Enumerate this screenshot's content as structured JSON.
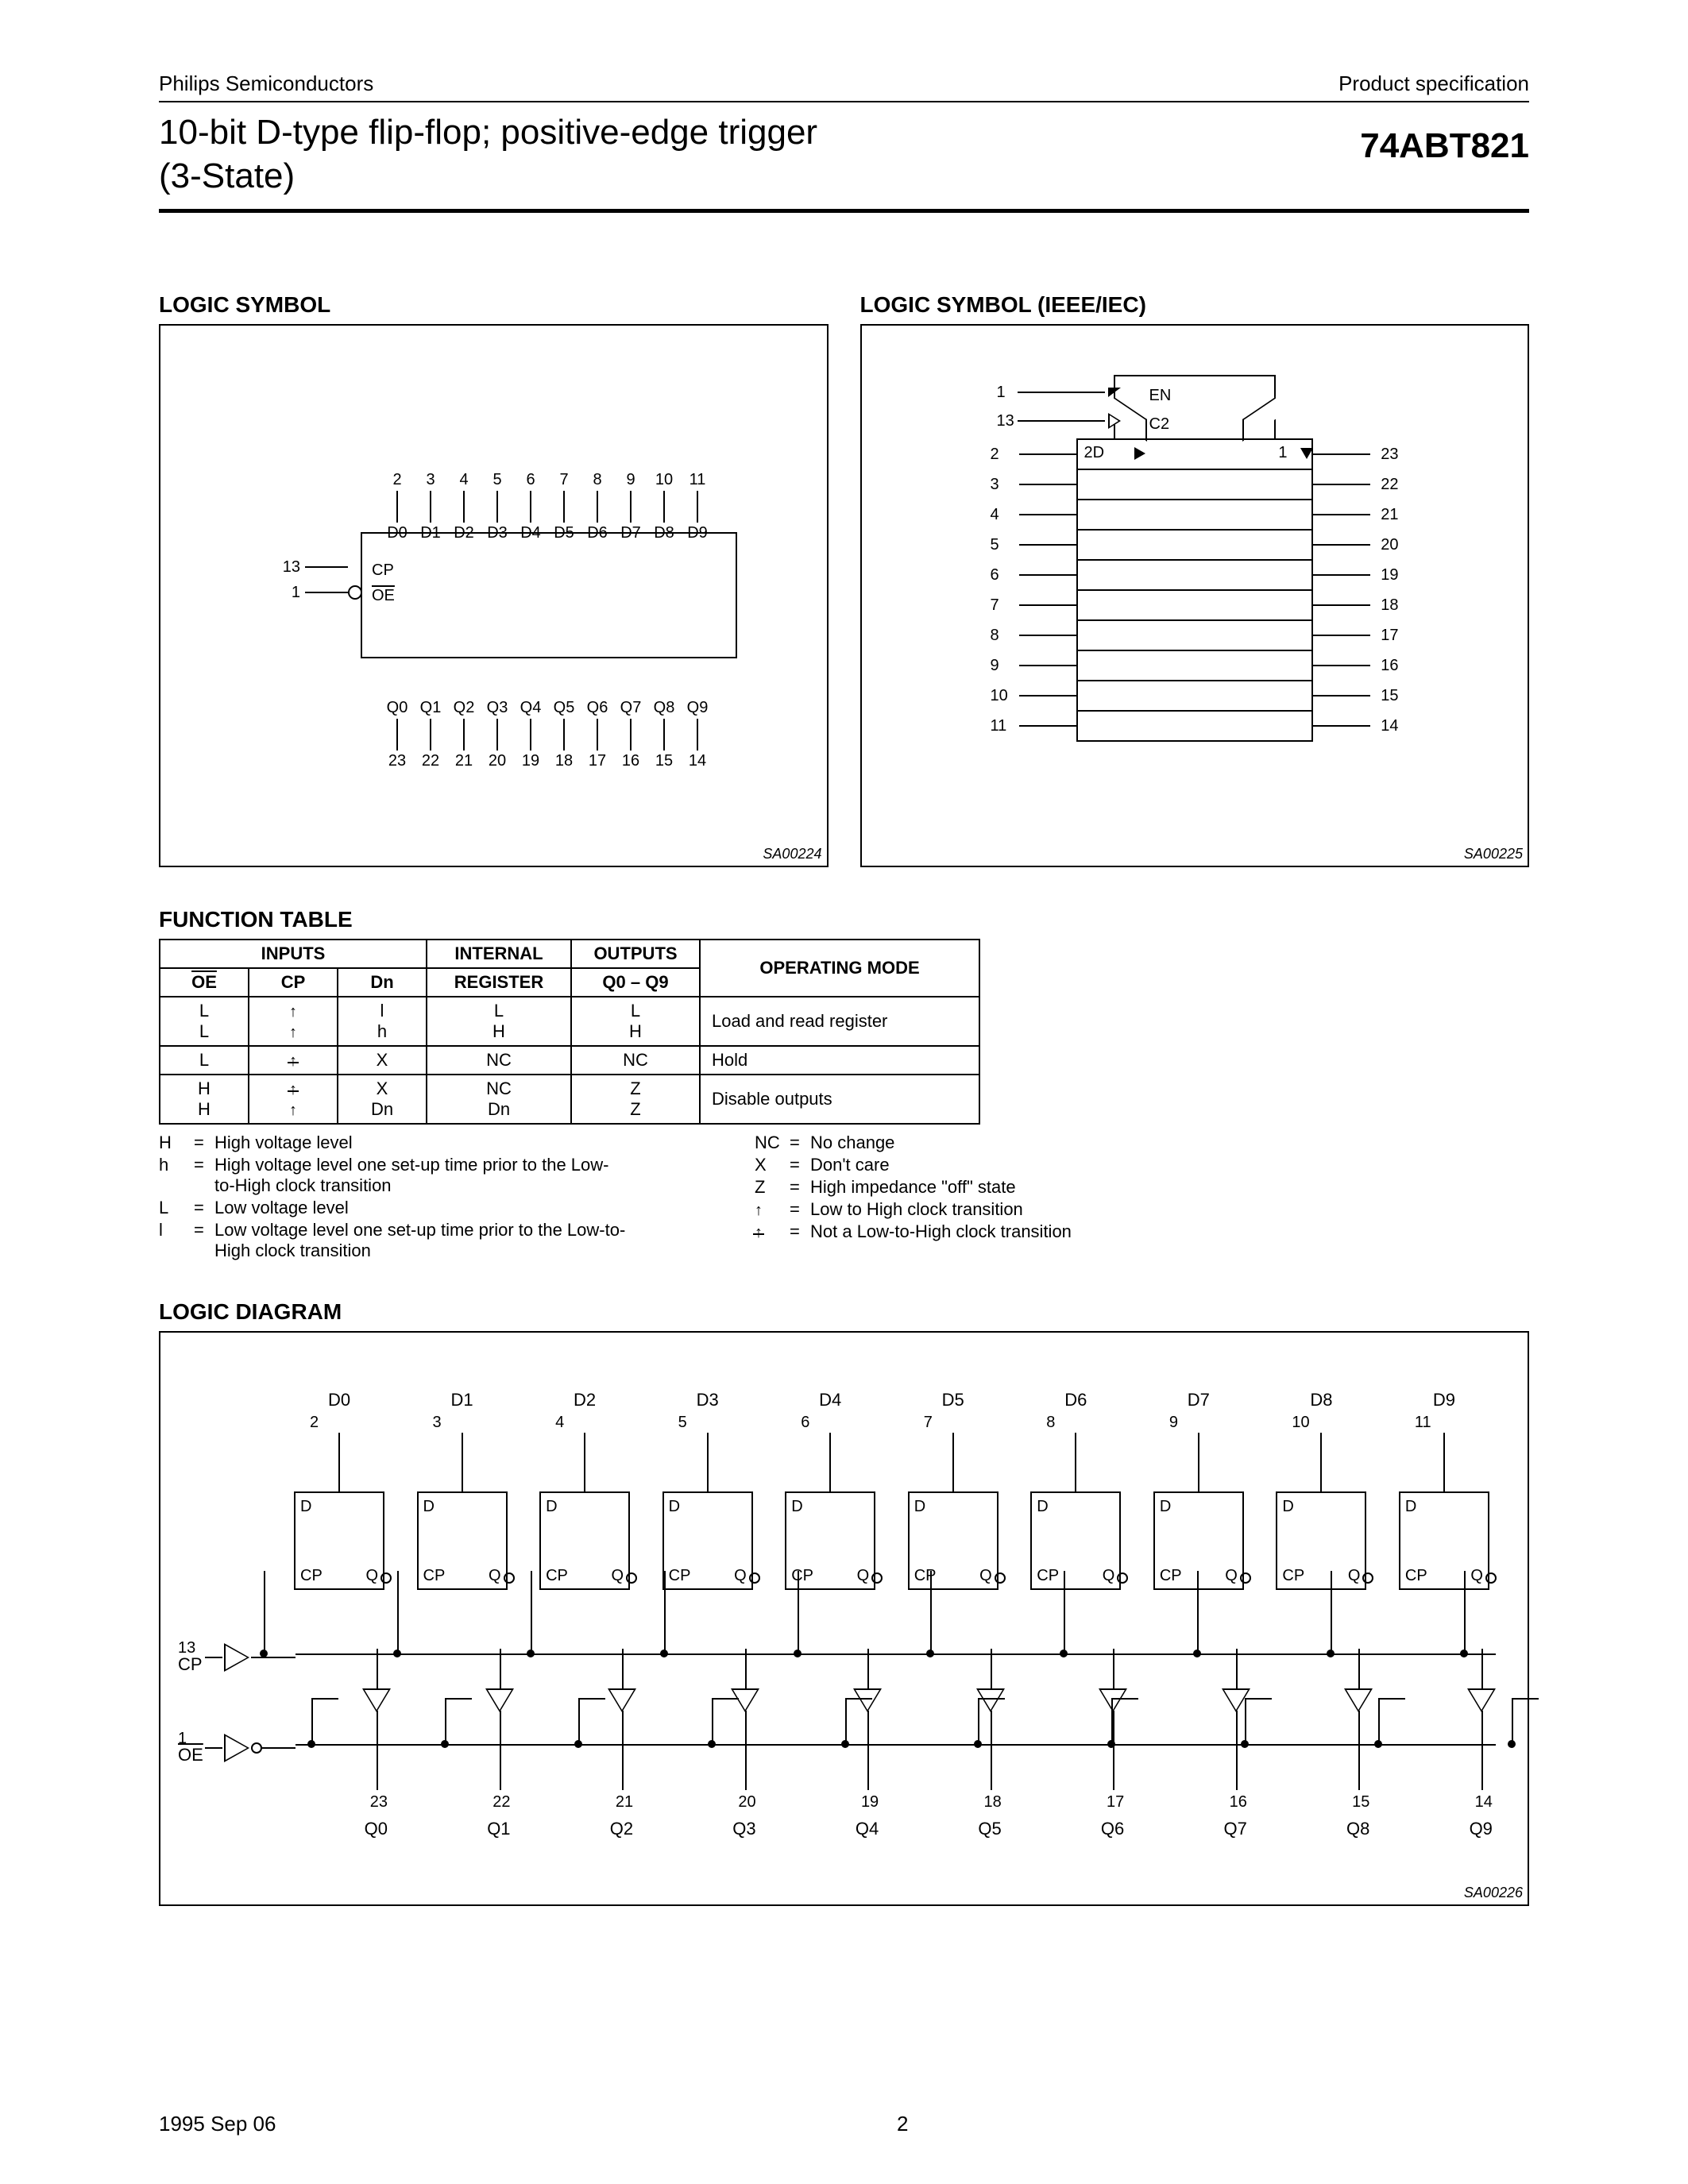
{
  "header": {
    "company": "Philips Semiconductors",
    "doc_type": "Product specification",
    "title_line1": "10-bit D-type flip-flop; positive-edge trigger",
    "title_line2": "(3-State)",
    "part_number": "74ABT821"
  },
  "sections": {
    "logic_symbol": "LOGIC SYMBOL",
    "logic_symbol_ieee": "LOGIC SYMBOL (IEEE/IEC)",
    "function_table": "FUNCTION TABLE",
    "logic_diagram": "LOGIC DIAGRAM"
  },
  "logic_symbol1": {
    "left_pins": [
      {
        "num": "13",
        "label": "CP",
        "inverted": false
      },
      {
        "num": "1",
        "label": "OE",
        "inverted": true
      }
    ],
    "top": {
      "nums": [
        "2",
        "3",
        "4",
        "5",
        "6",
        "7",
        "8",
        "9",
        "10",
        "11"
      ],
      "labels": [
        "D0",
        "D1",
        "D2",
        "D3",
        "D4",
        "D5",
        "D6",
        "D7",
        "D8",
        "D9"
      ]
    },
    "bottom": {
      "nums": [
        "23",
        "22",
        "21",
        "20",
        "19",
        "18",
        "17",
        "16",
        "15",
        "14"
      ],
      "labels": [
        "Q0",
        "Q1",
        "Q2",
        "Q3",
        "Q4",
        "Q5",
        "Q6",
        "Q7",
        "Q8",
        "Q9"
      ]
    },
    "id": "SA00224"
  },
  "logic_symbol2": {
    "ctrl_pins": [
      {
        "num": "1",
        "label": "EN",
        "symbol": "notch"
      },
      {
        "num": "13",
        "label": "C2",
        "symbol": "clock"
      }
    ],
    "row0_labels": [
      "2D",
      "1"
    ],
    "left_pins": [
      "2",
      "3",
      "4",
      "5",
      "6",
      "7",
      "8",
      "9",
      "10",
      "11"
    ],
    "right_pins": [
      "23",
      "22",
      "21",
      "20",
      "19",
      "18",
      "17",
      "16",
      "15",
      "14"
    ],
    "id": "SA00225"
  },
  "function_table": {
    "head1": [
      "INPUTS",
      "INTERNAL",
      "OUTPUTS",
      "OPERATING MODE"
    ],
    "head2": {
      "oe": "OE",
      "cp": "CP",
      "dn": "Dn",
      "reg": "REGISTER",
      "out": "Q0 – Q9"
    },
    "groups": [
      {
        "rows": [
          {
            "oe": "L",
            "cp": "↑",
            "dn": "l",
            "reg": "L",
            "out": "L"
          },
          {
            "oe": "L",
            "cp": "↑",
            "dn": "h",
            "reg": "H",
            "out": "H"
          }
        ],
        "mode": "Load and read register"
      },
      {
        "rows": [
          {
            "oe": "L",
            "cp": "⇑̸",
            "dn": "X",
            "reg": "NC",
            "out": "NC"
          }
        ],
        "mode": "Hold"
      },
      {
        "rows": [
          {
            "oe": "H",
            "cp": "⇑̸",
            "dn": "X",
            "reg": "NC",
            "out": "Z"
          },
          {
            "oe": "H",
            "cp": "↑",
            "dn": "Dn",
            "reg": "Dn",
            "out": "Z"
          }
        ],
        "mode": "Disable outputs"
      }
    ]
  },
  "legend": {
    "left": [
      {
        "sym": "H",
        "desc": "High voltage level"
      },
      {
        "sym": "h",
        "desc": "High voltage level one set-up time prior to the Low-to-High clock transition"
      },
      {
        "sym": "L",
        "desc": "Low voltage level"
      },
      {
        "sym": "l",
        "desc": "Low voltage level one set-up time prior to the Low-to-High clock transition"
      }
    ],
    "right": [
      {
        "sym": "NC",
        "desc": "No change"
      },
      {
        "sym": "X",
        "desc": "Don't care"
      },
      {
        "sym": "Z",
        "desc": "High impedance \"off\" state"
      },
      {
        "sym": "↑",
        "desc": "Low to High clock transition"
      },
      {
        "sym": "⇑̸",
        "desc": "Not a Low-to-High clock transition"
      }
    ]
  },
  "logic_diagram": {
    "cp": {
      "num": "13",
      "label": "CP"
    },
    "oe": {
      "num": "1",
      "label": "OE"
    },
    "flops": [
      {
        "d": "D0",
        "din": "2",
        "qout": "23",
        "q": "Q0"
      },
      {
        "d": "D1",
        "din": "3",
        "qout": "22",
        "q": "Q1"
      },
      {
        "d": "D2",
        "din": "4",
        "qout": "21",
        "q": "Q2"
      },
      {
        "d": "D3",
        "din": "5",
        "qout": "20",
        "q": "Q3"
      },
      {
        "d": "D4",
        "din": "6",
        "qout": "19",
        "q": "Q4"
      },
      {
        "d": "D5",
        "din": "7",
        "qout": "18",
        "q": "Q5"
      },
      {
        "d": "D6",
        "din": "8",
        "qout": "17",
        "q": "Q6"
      },
      {
        "d": "D7",
        "din": "9",
        "qout": "16",
        "q": "Q7"
      },
      {
        "d": "D8",
        "din": "10",
        "qout": "15",
        "q": "Q8"
      },
      {
        "d": "D9",
        "din": "11",
        "qout": "14",
        "q": "Q9"
      }
    ],
    "ff_labels": {
      "d": "D",
      "cp": "CP",
      "q": "Q"
    },
    "id": "SA00226"
  },
  "footer": {
    "date": "1995 Sep 06",
    "page": "2"
  }
}
